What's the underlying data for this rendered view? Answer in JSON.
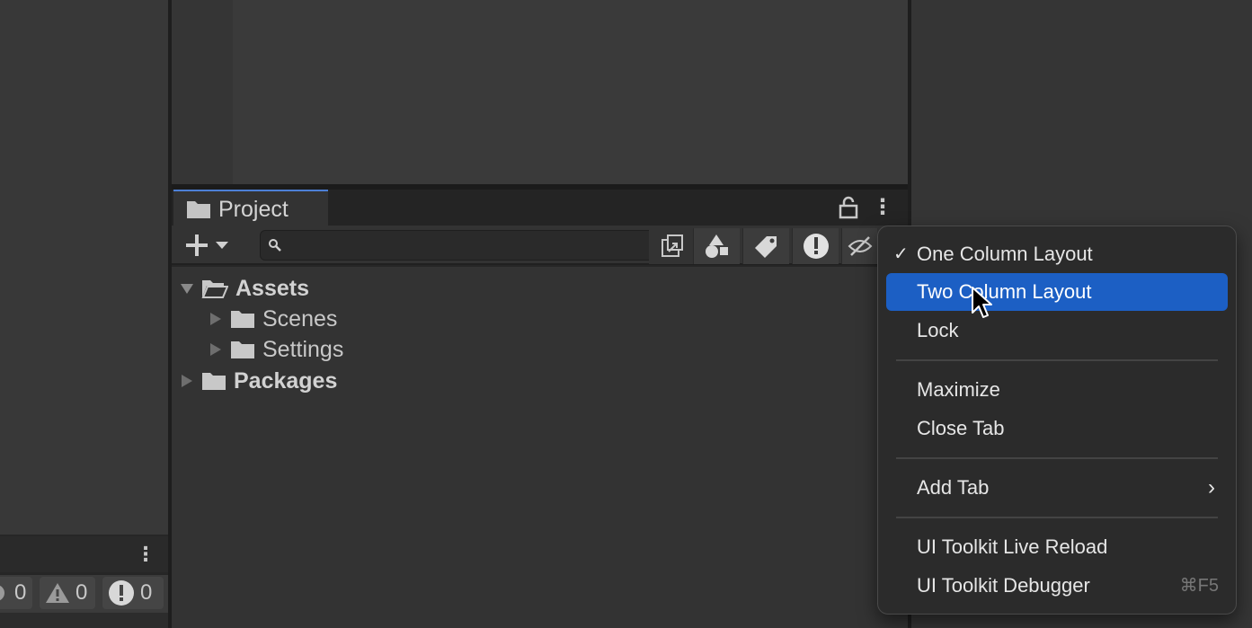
{
  "project_tab": {
    "title": "Project"
  },
  "search": {
    "placeholder": ""
  },
  "tree": {
    "assets": "Assets",
    "scenes": "Scenes",
    "settings": "Settings",
    "packages": "Packages"
  },
  "console": {
    "log_count": "0",
    "warning_count": "0",
    "error_count": "0"
  },
  "context_menu": {
    "one_column": "One Column Layout",
    "one_column_check": "✓",
    "two_column": "Two Column Layout",
    "lock": "Lock",
    "maximize": "Maximize",
    "close_tab": "Close Tab",
    "add_tab": "Add Tab",
    "add_tab_arrow": "›",
    "ui_live_reload": "UI Toolkit Live Reload",
    "ui_debugger": "UI Toolkit Debugger",
    "ui_debugger_shortcut": "⌘F5"
  },
  "colors": {
    "highlight": "#1c5fc4",
    "tab_accent": "#4c7fd6",
    "panel": "#333333"
  }
}
